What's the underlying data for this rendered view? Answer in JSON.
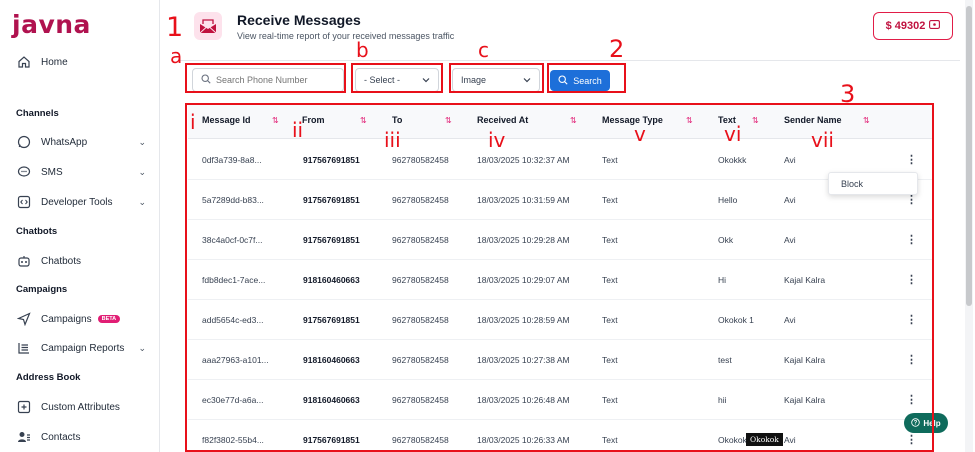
{
  "brand": {
    "logo": "javna"
  },
  "sidebar": {
    "home": "Home",
    "sections": {
      "channels": "Channels",
      "chatbots": "Chatbots",
      "campaigns": "Campaigns",
      "address_book": "Address Book"
    },
    "items": {
      "whatsapp": "WhatsApp",
      "sms": "SMS",
      "developer_tools": "Developer Tools",
      "chatbots": "Chatbots",
      "campaigns": "Campaigns",
      "campaigns_badge": "BETA",
      "campaign_reports": "Campaign Reports",
      "custom_attributes": "Custom Attributes",
      "contacts": "Contacts"
    }
  },
  "header": {
    "title": "Receive Messages",
    "subtitle": "View real-time report of your received messages traffic",
    "balance": "$ 49302"
  },
  "filters": {
    "search_placeholder": "Search Phone Number",
    "select_value": "- Select -",
    "type_value": "Image",
    "search_button": "Search"
  },
  "table": {
    "columns": [
      "Message Id",
      "From",
      "To",
      "Received At",
      "Message Type",
      "Text",
      "Sender Name"
    ],
    "rows": [
      [
        "0df3a739-8a8...",
        "917567691851",
        "962780582458",
        "18/03/2025 10:32:37 AM",
        "Text",
        "Okokkk",
        "Avi"
      ],
      [
        "5a7289dd-b83...",
        "917567691851",
        "962780582458",
        "18/03/2025 10:31:59 AM",
        "Text",
        "Hello",
        "Avi"
      ],
      [
        "38c4a0cf-0c7f...",
        "917567691851",
        "962780582458",
        "18/03/2025 10:29:28 AM",
        "Text",
        "Okk",
        "Avi"
      ],
      [
        "fdb8dec1-7ace...",
        "918160460663",
        "962780582458",
        "18/03/2025 10:29:07 AM",
        "Text",
        "Hi",
        "Kajal Kalra"
      ],
      [
        "add5654c-ed3...",
        "917567691851",
        "962780582458",
        "18/03/2025 10:28:59 AM",
        "Text",
        "Okokok 1",
        "Avi"
      ],
      [
        "aaa27963-a101...",
        "918160460663",
        "962780582458",
        "18/03/2025 10:27:38 AM",
        "Text",
        "test",
        "Kajal Kalra"
      ],
      [
        "ec30e77d-a6a...",
        "918160460663",
        "962780582458",
        "18/03/2025 10:26:48 AM",
        "Text",
        "hii",
        "Kajal Kalra"
      ],
      [
        "f82f3802-55b4...",
        "917567691851",
        "962780582458",
        "18/03/2025 10:26:33 AM",
        "Text",
        "Okokok",
        "Avi"
      ]
    ],
    "row_menu_item": "Block",
    "tooltip": "Okokok"
  },
  "help_button": "Help",
  "annotations": {
    "n1": "1",
    "n2": "2",
    "n3": "3",
    "a": "a",
    "b": "b",
    "c": "c",
    "i": "i",
    "ii": "ii",
    "iii": "iii",
    "iv": "iv",
    "v": "v",
    "vi": "vi",
    "vii": "vii"
  },
  "colors": {
    "brand": "#b0124f",
    "primary": "#1d6fd9",
    "annotation": "#e8101a",
    "help": "#0f6b5c"
  }
}
